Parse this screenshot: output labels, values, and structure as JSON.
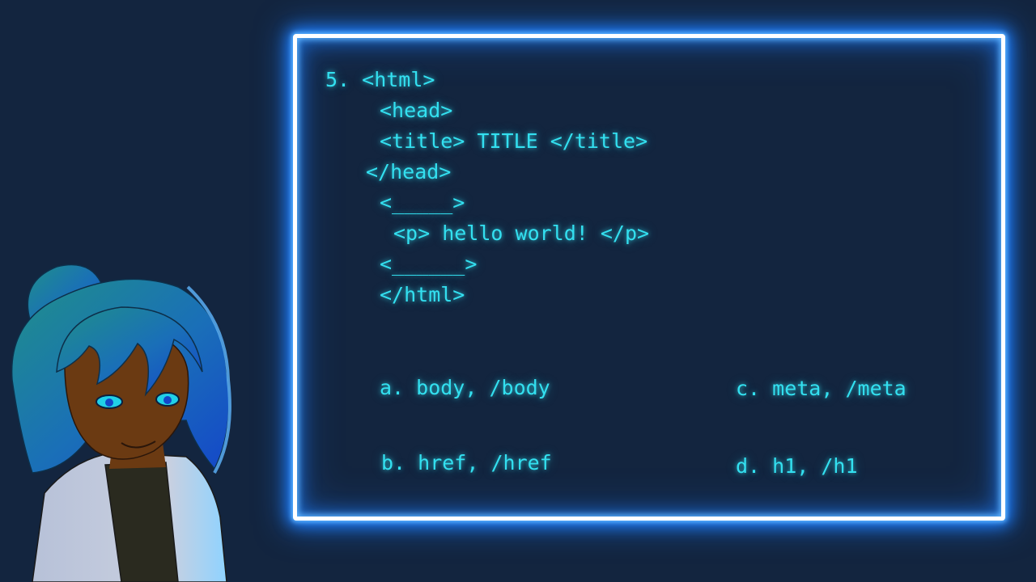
{
  "question": {
    "code_lines": [
      "5. <html>",
      "<head>",
      "<title> TITLE </title>",
      "</head>",
      "<_____>",
      "<p> hello world! </p>",
      "<______>",
      "</html>"
    ],
    "options": [
      "a. body, /body",
      "b. href, /href",
      "c. meta, /meta",
      "d. h1, /h1"
    ]
  },
  "colors": {
    "background": "#13253f",
    "code_text": "#33e0f0",
    "frame_glow": "#1e7dff"
  }
}
